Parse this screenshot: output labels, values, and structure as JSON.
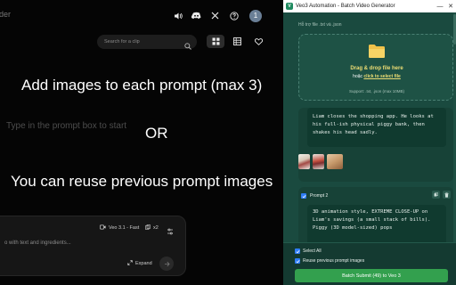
{
  "left_app": {
    "title_fragment": "der",
    "search_placeholder": "Search for a clip",
    "avatar_letter": "1",
    "overlay": {
      "line1": "Add images to each prompt (max 3)",
      "line2": "OR",
      "line3": "You can reuse previous prompt images"
    },
    "prompt_hint": "Type in the prompt box to start",
    "composer": {
      "placeholder": "o with text and ingredients...",
      "model": "Veo 3.1 - Fast",
      "multiplier": "x2",
      "expand": "Expand"
    }
  },
  "extension": {
    "app_initial": "V",
    "window_title": "Veo3 Automation - Batch Video Generator",
    "top_hint": "Hỗ trợ file .txt và .json",
    "dropzone": {
      "title": "Drag & drop file here",
      "sub_prefix": "hoặc",
      "sub_link": "click to select file",
      "support": "Support: .txt, .json (max 10MB)"
    },
    "prompt1": {
      "text": "Liam closes the shopping app. He looks at his full-ish physical piggy bank, then shakes his head sadly."
    },
    "prompt2": {
      "label": "Prompt 2",
      "text": "3D animation style, EXTREME CLOSE-UP on Liam's savings (a small stack of bills). Piggy (3D model-sized) pops"
    },
    "options": {
      "select_all": "Select All",
      "reuse": "Reuse previous prompt images"
    },
    "submit_label": "Batch Submit (49) to Veo 3"
  },
  "colors": {
    "accent_green": "#33a04e",
    "folder_yellow": "#f0c24a",
    "link_yellow": "#eede74",
    "panel_bg": "#1a4a3f"
  },
  "icons": [
    "volume-icon",
    "discord-icon",
    "x-icon",
    "help-icon",
    "search-icon",
    "grid-icon",
    "list-icon",
    "heart-icon",
    "folder-icon",
    "copy-icon",
    "trash-icon",
    "expand-icon",
    "send-icon",
    "tune-icon"
  ]
}
